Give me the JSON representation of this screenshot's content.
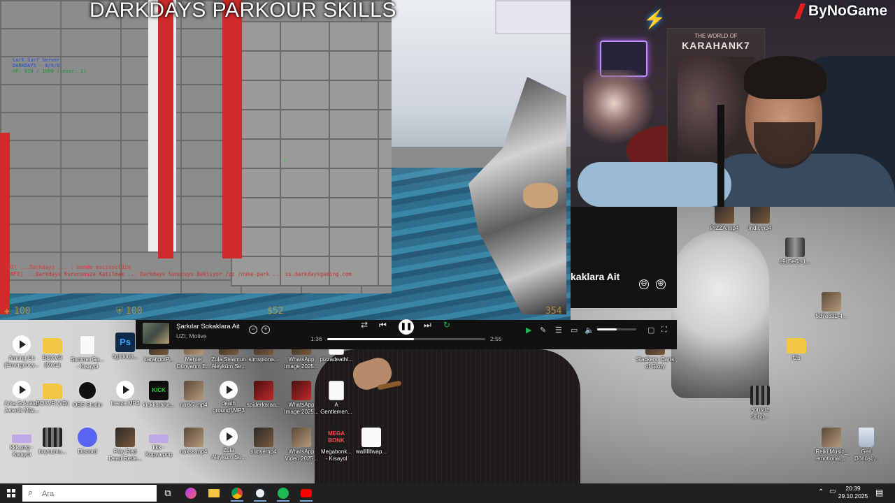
{
  "game": {
    "title": "DARKDAYS PARKOUR SKİLLS",
    "hud_server_lines": [
      "Lurt Surf Server",
      "DARKDAYS - 0/0/0",
      "HP: 819 / 1000 (lever: 1)"
    ],
    "chat_lines": [
      "[DD] ...Darkdays ... : bende escinseldim",
      "[INFO] ...Darkdays Kurucunuza Katilmak ... Darkdays Sunucuyu Bekliyor /zz /nuke-park ... ss.darkdaysgaming.com"
    ],
    "hud_health": "100",
    "hud_armor": "100",
    "hud_money": "$52",
    "hud_ammo": "354"
  },
  "webcam": {
    "brand": "ByNoGame",
    "poster_subtitle": "THE WORLD OF",
    "poster_title": "KARAHANK7"
  },
  "spotify_panel": {
    "title_fragment": "kaklara Ait",
    "minus_icon": "⊖",
    "plus_icon": "⊕"
  },
  "miniplayer": {
    "track_title": "Şarkılar Sokaklara Ait",
    "artist": "UZI, Motive",
    "time_current": "1:36",
    "time_total": "2:55",
    "progress_fraction": 0.55,
    "volume_fraction": 0.5,
    "controls": {
      "shuffle": "⇄",
      "previous": "⏮",
      "play_pause": "❚❚",
      "next": "⏭",
      "repeat": "↻"
    },
    "right_controls": [
      "▶",
      "✎",
      "☰",
      "▭",
      "🔈",
      "▢",
      "⛶"
    ]
  },
  "desktop_icons": [
    {
      "label": "Among Us\n(Emergency...",
      "type": "video"
    },
    {
      "label": "BOXVR\n(Meta)",
      "type": "folder"
    },
    {
      "label": "SummerGa...\n- Kısayol",
      "type": "doc"
    },
    {
      "label": "fightklub...",
      "type": "ps"
    },
    {
      "label": "karahpotP...",
      "type": "dark"
    },
    {
      "label": "Mehter\nDünyanın E...",
      "type": "photo"
    },
    {
      "label": "Zula Selamun\nAleyküm Se...",
      "type": "dark"
    },
    {
      "label": "simspiona...",
      "type": "dark"
    },
    {
      "label": "WhatsApp\nImage 2025...",
      "type": "dark"
    },
    {
      "label": "pizzadeathl...",
      "type": "doc"
    },
    {
      "label": "Arka Sokaklar\nJenerik Müz...",
      "type": "video"
    },
    {
      "label": "BOXVR (VD)",
      "type": "folder"
    },
    {
      "label": "OBS Studio",
      "type": "obs"
    },
    {
      "label": "freeze.MP3",
      "type": "video"
    },
    {
      "label": "kickkaraha...",
      "type": "green"
    },
    {
      "label": "nakk7.mp4",
      "type": "photo"
    },
    {
      "label": "death\nground].MP3",
      "type": "video"
    },
    {
      "label": "spiderkaraa...",
      "type": "red"
    },
    {
      "label": "WhatsApp\nImage 2025...",
      "type": "red"
    },
    {
      "label": "A\nGentlemen...",
      "type": "doc"
    },
    {
      "label": "kkk.png -\nKısayol",
      "type": "purple"
    },
    {
      "label": "boynumu...",
      "type": "film"
    },
    {
      "label": "Discord",
      "type": "discord"
    },
    {
      "label": "Play Red\nDead Rede...",
      "type": "dark"
    },
    {
      "label": "kkk -\nKopya.png",
      "type": "purple"
    },
    {
      "label": "nakss.mp4",
      "type": "photo"
    },
    {
      "label": "Zula\nAleyküm Se...",
      "type": "video"
    },
    {
      "label": "subyemp4",
      "type": "dark"
    },
    {
      "label": "WhatsApp\nVideo 2025...",
      "type": "photo"
    },
    {
      "label": "Megabonk...\n- Kısayol",
      "type": "mega"
    },
    {
      "label": "walllllllwap...",
      "type": "white"
    },
    {
      "label": "PIZZA.mp4",
      "type": "dark"
    },
    {
      "label": "indir.mp4",
      "type": "dark"
    },
    {
      "label": "e9d5e6c-1...",
      "type": "gray"
    },
    {
      "label": "5d7e831-4...",
      "type": "photo"
    },
    {
      "label": "Slackers: Carts\nof Glory",
      "type": "dark"
    },
    {
      "label": "f2b",
      "type": "folder"
    },
    {
      "label": "sonsuz\ndöng...",
      "type": "film"
    },
    {
      "label": "Reiki Music_\nemotional ...",
      "type": "photo"
    },
    {
      "label": "Geri\nDönüşü...",
      "type": "recycle"
    }
  ],
  "desktop_icon_megabonk_text": "MEGA\nBONK",
  "taskbar": {
    "search_placeholder": "Ara",
    "apps": [
      "task-view",
      "messenger",
      "file-explorer",
      "chrome",
      "steam",
      "spotify",
      "youtube"
    ],
    "tray_icons": [
      "⌃",
      "▭",
      "🔊"
    ],
    "time": "20:39",
    "date": "29.10.2025"
  },
  "colors": {
    "spotify_green": "#1db954",
    "taskbar": "#202020",
    "game_red_stripe": "#d02b2b"
  }
}
